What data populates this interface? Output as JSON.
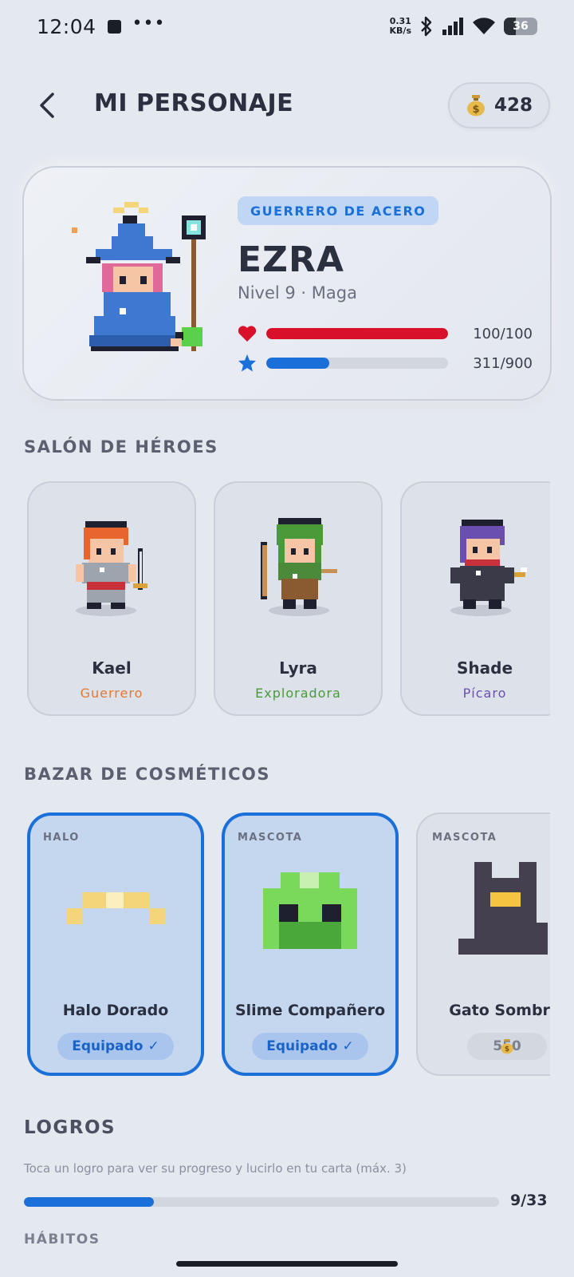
{
  "status_bar": {
    "time": "12:04",
    "net_speed_value": "0.31",
    "net_speed_unit": "KB/s",
    "battery": "36"
  },
  "header": {
    "title": "MI PERSONAJE",
    "coins": "428"
  },
  "hero": {
    "badge": "GUERRERO DE ACERO",
    "name": "EZRA",
    "subtitle": "Nivel 9 · Maga",
    "hp_text": "100/100",
    "hp_fraction": 1.0,
    "xp_text": "311/900",
    "xp_fraction": 0.3456
  },
  "hall": {
    "title": "SALÓN DE HÉROES",
    "heroes": [
      {
        "name": "Kael",
        "class": "Guerrero",
        "color": "#e8772e"
      },
      {
        "name": "Lyra",
        "class": "Exploradora",
        "color": "#4a9a3a"
      },
      {
        "name": "Shade",
        "class": "Pícaro",
        "color": "#6a4fb0"
      }
    ]
  },
  "bazaar": {
    "title": "BAZAR DE COSMÉTICOS",
    "items": [
      {
        "type": "HALO",
        "name": "Halo Dorado",
        "status": "Equipado",
        "check": "✓"
      },
      {
        "type": "MASCOTA",
        "name": "Slime Compañero",
        "status": "Equipado",
        "check": "✓"
      },
      {
        "type": "MASCOTA",
        "name": "Gato Sombra",
        "price": "550"
      }
    ]
  },
  "achievements": {
    "title": "LOGROS",
    "description": "Toca un logro para ver su progreso y lucirlo en tu carta (máx. 3)",
    "count": "9/33",
    "fraction": 0.2727
  },
  "habits": {
    "title": "HÁBITOS"
  },
  "colors": {
    "accent": "#1a6fd8",
    "hp": "#d9102a",
    "background": "#e4e8ef"
  }
}
